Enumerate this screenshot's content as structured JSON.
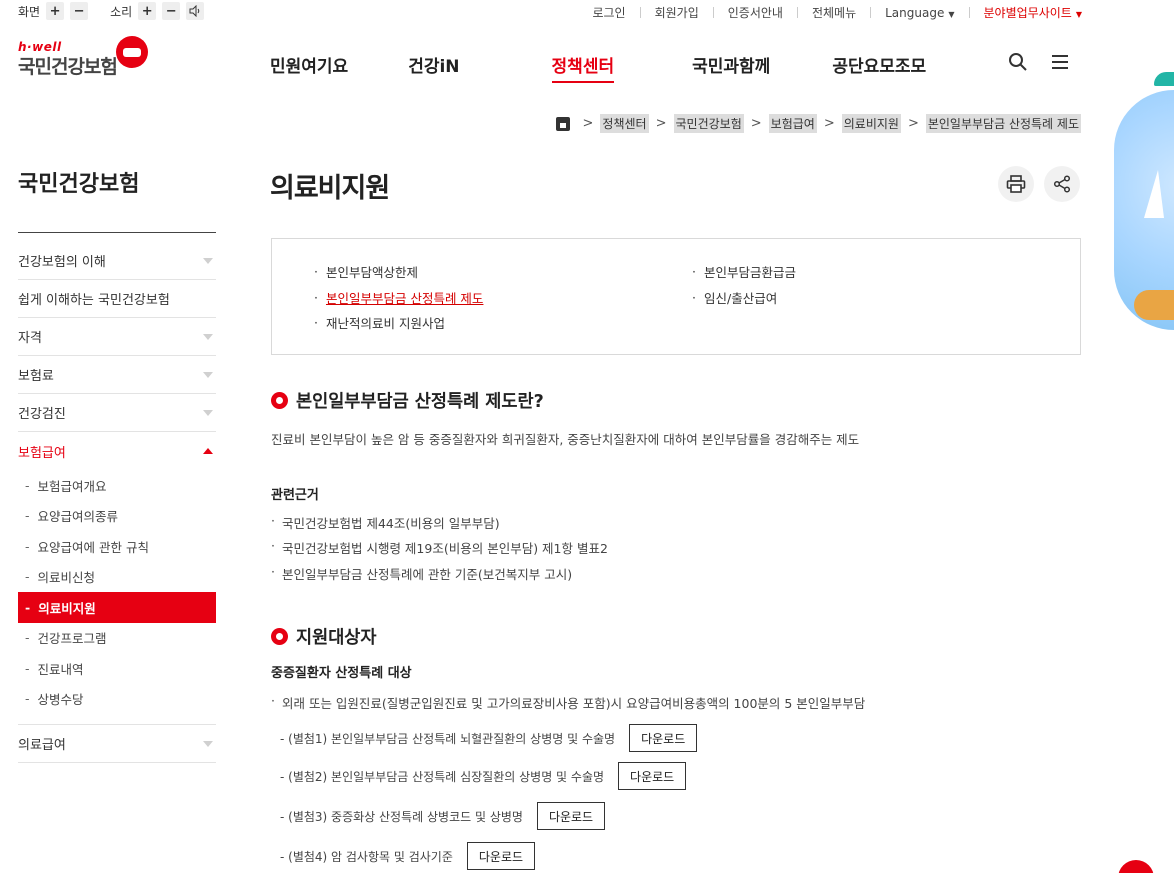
{
  "util": {
    "screen_label": "화면",
    "sound_label": "소리",
    "plus": "+",
    "minus": "−",
    "links": [
      "로그인",
      "회원가입",
      "인증서안내",
      "전체메뉴"
    ],
    "language": "Language",
    "site_link": "분야별업무사이트"
  },
  "logo": {
    "small": "h·well",
    "main": "국민건강보험"
  },
  "gnb": [
    "민원여기요",
    "건강iN",
    "정책센터",
    "국민과함께",
    "공단요모조모"
  ],
  "breadcrumb": [
    "정책센터",
    "국민건강보험",
    "보험급여",
    "의료비지원",
    "본인일부부담금 산정특례 제도"
  ],
  "sidebar": {
    "title": "국민건강보험",
    "items": [
      "건강보험의 이해",
      "쉽게 이해하는 국민건강보험",
      "자격",
      "보험료",
      "건강검진",
      "보험급여"
    ],
    "sub_items": [
      "보험급여개요",
      "요양급여의종류",
      "요양급여에 관한 규칙",
      "의료비신청",
      "의료비지원",
      "건강프로그램",
      "진료내역",
      "상병수당"
    ],
    "last_item": "의료급여"
  },
  "page": {
    "title": "의료비지원"
  },
  "toc": {
    "col1": [
      "본인부담액상한제",
      "본인일부부담금 산정특례 제도",
      "재난적의료비 지원사업"
    ],
    "col2": [
      "본인부담금환급금",
      "임신/출산급여"
    ]
  },
  "sec1": {
    "title": "본인일부부담금 산정특례 제도란?",
    "desc": "진료비 본인부담이 높은 암 등 중증질환자와 희귀질환자, 중증난치질환자에 대하여 본인부담률을 경감해주는 제도",
    "basis_title": "관련근거",
    "basis": [
      "국민건강보험법 제44조(비용의 일부부담)",
      "국민건강보험법 시행령 제19조(비용의 본인부담) 제1항 별표2",
      "본인일부부담금 산정특례에 관한 기준(보건복지부 고시)"
    ]
  },
  "sec2": {
    "title": "지원대상자",
    "subtitle": "중증질환자 산정특례 대상",
    "bullet": "외래 또는 입원진료(질병군입원진료 및 고가의료장비사용 포함)시 요양급여비용총액의 100분의 5 본인일부부담",
    "attachments": [
      "- (별첨1) 본인일부부담금 산정특례 뇌혈관질환의 상병명 및 수술명",
      "- (별첨2) 본인일부부담금 산정특례 심장질환의 상병명 및 수술명",
      "- (별첨3) 중증화상 산정특례 상병코드 및 상병명",
      "- (별첨4) 암 검사항목 및 검사기준"
    ],
    "download_label": "다운로드"
  }
}
